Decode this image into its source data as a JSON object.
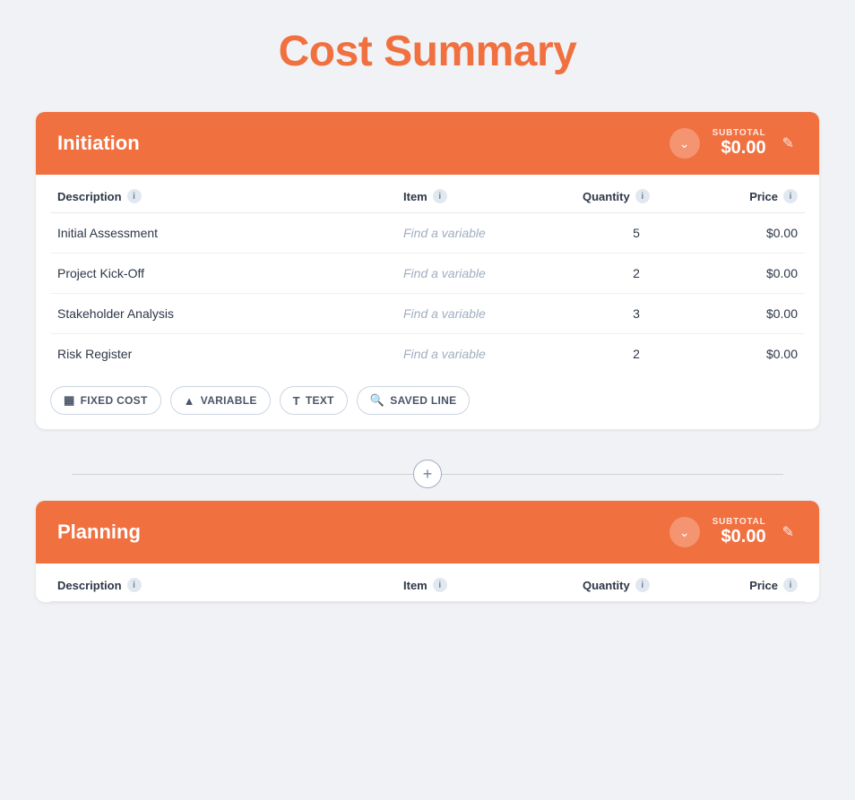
{
  "page": {
    "title": "Cost Summary"
  },
  "sections": [
    {
      "id": "initiation",
      "title": "Initiation",
      "subtotal_label": "SUBTOTAL",
      "subtotal_amount": "$0.00",
      "columns": [
        "Description",
        "Item",
        "Quantity",
        "Price"
      ],
      "rows": [
        {
          "description": "Initial Assessment",
          "item_placeholder": "Find a variable",
          "quantity": "5",
          "price": "$0.00"
        },
        {
          "description": "Project Kick-Off",
          "item_placeholder": "Find a variable",
          "quantity": "2",
          "price": "$0.00"
        },
        {
          "description": "Stakeholder Analysis",
          "item_placeholder": "Find a variable",
          "quantity": "3",
          "price": "$0.00"
        },
        {
          "description": "Risk Register",
          "item_placeholder": "Find a variable",
          "quantity": "2",
          "price": "$0.00"
        }
      ],
      "actions": [
        {
          "id": "fixed-cost",
          "icon": "▦",
          "label": "FIXED COST"
        },
        {
          "id": "variable",
          "icon": "▲",
          "label": "VARIABLE"
        },
        {
          "id": "text",
          "icon": "T",
          "label": "TEXT"
        },
        {
          "id": "saved-line",
          "icon": "🔍",
          "label": "SAVED LINE"
        }
      ]
    },
    {
      "id": "planning",
      "title": "Planning",
      "subtotal_label": "SUBTOTAL",
      "subtotal_amount": "$0.00",
      "columns": [
        "Description",
        "Item",
        "Quantity",
        "Price"
      ],
      "rows": [],
      "actions": []
    }
  ],
  "add_section_label": "+"
}
